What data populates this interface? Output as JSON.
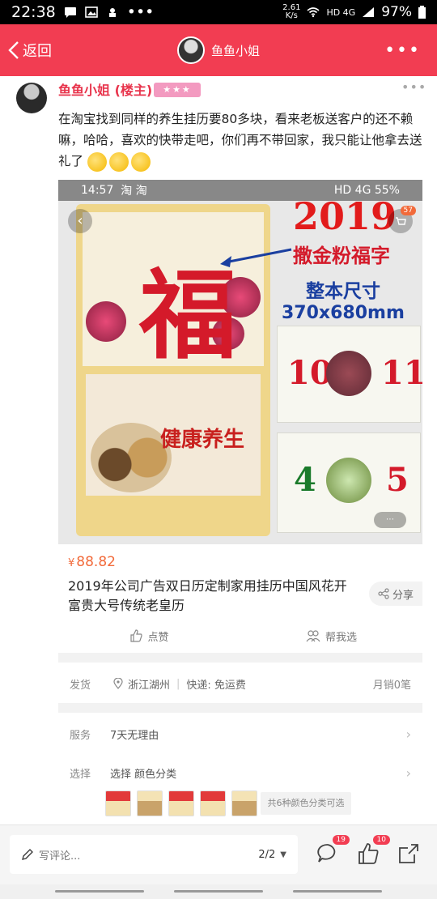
{
  "status_bar": {
    "time": "22:38",
    "speed_top": "2.61",
    "speed_bottom": "K/s",
    "network": "HD 4G",
    "battery": "97%"
  },
  "header": {
    "back_label": "返回",
    "title": "鱼鱼小姐",
    "more": "•••"
  },
  "post": {
    "author": "鱼鱼小姐 (楼主)",
    "badge_stars": "★★★",
    "more": "•••",
    "text": "在淘宝找到同样的养生挂历要80多块，看来老板送客户的还不赖嘛，哈哈，喜欢的快带走吧，你们再不带回家，我只能让他拿去送礼了"
  },
  "image": {
    "status_time": "14:57",
    "status_apps": "淘 淘",
    "status_battery": "HD 4G 55%",
    "year": "2019",
    "sub1": "撒金粉福字",
    "sub2": "整本尺寸",
    "sub3": "370x680mm",
    "fu": "福",
    "health": "健康养生",
    "cart_count": "57",
    "thumbs": [
      "10",
      "11",
      "4",
      "5"
    ]
  },
  "product": {
    "currency": "¥",
    "price": "88.82",
    "title": "2019年公司广告双日历定制家用挂历中国风花开富贵大号传统老皇历",
    "share_label": "分享",
    "like_label": "点赞",
    "help_label": "帮我选"
  },
  "shipping": {
    "label": "发货",
    "location": "浙江湖州",
    "delivery": "快递: 免运费",
    "sales": "月销0笔"
  },
  "service": {
    "label": "服务",
    "value": "7天无理由"
  },
  "select": {
    "label": "选择",
    "value": "选择 颜色分类",
    "note": "共6种颜色分类可选"
  },
  "bottom": {
    "placeholder": "写评论...",
    "pager": "2/2",
    "comment_count": "19",
    "like_count": "10"
  },
  "colors": {
    "brand_red": "#f23d52",
    "price_orange": "#f26a3a",
    "author_pink": "#e8344c"
  }
}
